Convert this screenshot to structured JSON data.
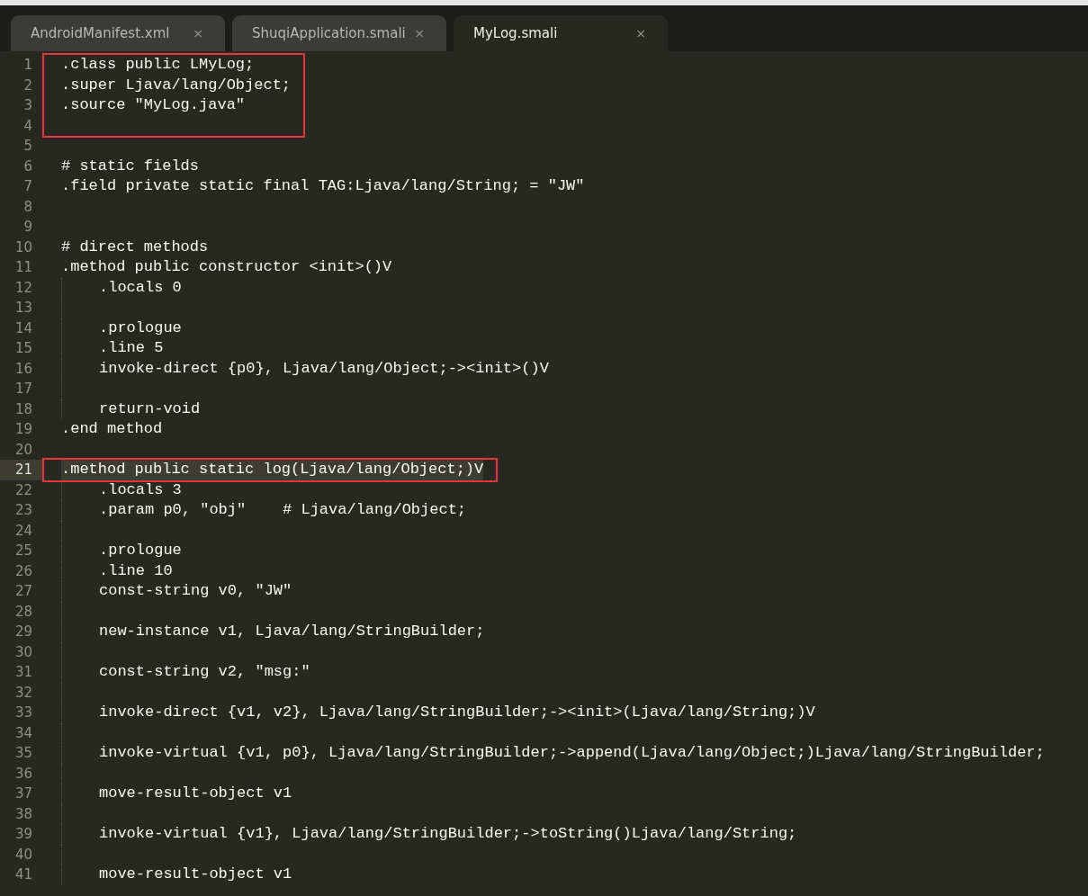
{
  "tabs": [
    {
      "label": "AndroidManifest.xml",
      "selected": false,
      "close": "×"
    },
    {
      "label": "ShuqiApplication.smali",
      "selected": false,
      "close": "×"
    },
    {
      "label": "MyLog.smali",
      "selected": true,
      "close": "×"
    }
  ],
  "editor": {
    "segments": [
      {
        "boxed": true,
        "lines": [
          {
            "number": "1",
            "text": ".class public LMyLog;",
            "indent": false,
            "current": false
          },
          {
            "number": "2",
            "text": ".super Ljava/lang/Object;",
            "indent": false,
            "current": false
          },
          {
            "number": "3",
            "text": ".source \"MyLog.java\"",
            "indent": false,
            "current": false
          },
          {
            "number": "4",
            "indent": false,
            "current": false
          }
        ]
      },
      {
        "boxed": false,
        "lines": [
          {
            "number": "5",
            "indent": false,
            "current": false
          },
          {
            "number": "6",
            "text": "# static fields",
            "indent": false,
            "current": false
          },
          {
            "number": "7",
            "text": ".field private static final TAG:Ljava/lang/String; = \"JW\"",
            "indent": false,
            "current": false
          },
          {
            "number": "8",
            "indent": false,
            "current": false
          },
          {
            "number": "9",
            "indent": false,
            "current": false
          },
          {
            "number": "10",
            "text": "# direct methods",
            "indent": false,
            "current": false
          },
          {
            "number": "11",
            "text": ".method public constructor <init>()V",
            "indent": false,
            "current": false
          },
          {
            "number": "12",
            "text": ".locals 0",
            "indent": true,
            "current": false
          },
          {
            "number": "13",
            "indent": true,
            "current": false
          },
          {
            "number": "14",
            "text": ".prologue",
            "indent": true,
            "current": false
          },
          {
            "number": "15",
            "text": ".line 5",
            "indent": true,
            "current": false
          },
          {
            "number": "16",
            "text": "invoke-direct {p0}, Ljava/lang/Object;-><init>()V",
            "indent": true,
            "current": false
          },
          {
            "number": "17",
            "indent": true,
            "current": false
          },
          {
            "number": "18",
            "text": "return-void",
            "indent": true,
            "current": false
          },
          {
            "number": "19",
            "text": ".end method",
            "indent": false,
            "current": false
          },
          {
            "number": "20",
            "indent": false,
            "current": false
          }
        ]
      },
      {
        "boxed": true,
        "lines": [
          {
            "number": "21",
            "text": ".method public static log(Ljava/lang/Object;)V",
            "indent": false,
            "current": true
          }
        ]
      },
      {
        "boxed": false,
        "lines": [
          {
            "number": "22",
            "text": ".locals 3",
            "indent": true,
            "current": false
          },
          {
            "number": "23",
            "text": ".param p0, \"obj\"    # Ljava/lang/Object;",
            "indent": true,
            "current": false
          },
          {
            "number": "24",
            "indent": true,
            "current": false
          },
          {
            "number": "25",
            "text": ".prologue",
            "indent": true,
            "current": false
          },
          {
            "number": "26",
            "text": ".line 10",
            "indent": true,
            "current": false
          },
          {
            "number": "27",
            "text": "const-string v0, \"JW\"",
            "indent": true,
            "current": false
          },
          {
            "number": "28",
            "indent": true,
            "current": false
          },
          {
            "number": "29",
            "text": "new-instance v1, Ljava/lang/StringBuilder;",
            "indent": true,
            "current": false
          },
          {
            "number": "30",
            "indent": true,
            "current": false
          },
          {
            "number": "31",
            "text": "const-string v2, \"msg:\"",
            "indent": true,
            "current": false
          },
          {
            "number": "32",
            "indent": true,
            "current": false
          },
          {
            "number": "33",
            "text": "invoke-direct {v1, v2}, Ljava/lang/StringBuilder;-><init>(Ljava/lang/String;)V",
            "indent": true,
            "current": false
          },
          {
            "number": "34",
            "indent": true,
            "current": false
          },
          {
            "number": "35",
            "text": "invoke-virtual {v1, p0}, Ljava/lang/StringBuilder;->append(Ljava/lang/Object;)Ljava/lang/StringBuilder;",
            "indent": true,
            "current": false
          },
          {
            "number": "36",
            "indent": true,
            "current": false
          },
          {
            "number": "37",
            "text": "move-result-object v1",
            "indent": true,
            "current": false
          },
          {
            "number": "38",
            "indent": true,
            "current": false
          },
          {
            "number": "39",
            "text": "invoke-virtual {v1}, Ljava/lang/StringBuilder;->toString()Ljava/lang/String;",
            "indent": true,
            "current": false
          },
          {
            "number": "40",
            "indent": true,
            "current": false
          },
          {
            "number": "41",
            "text": "move-result-object v1",
            "indent": true,
            "current": false
          }
        ]
      }
    ]
  }
}
